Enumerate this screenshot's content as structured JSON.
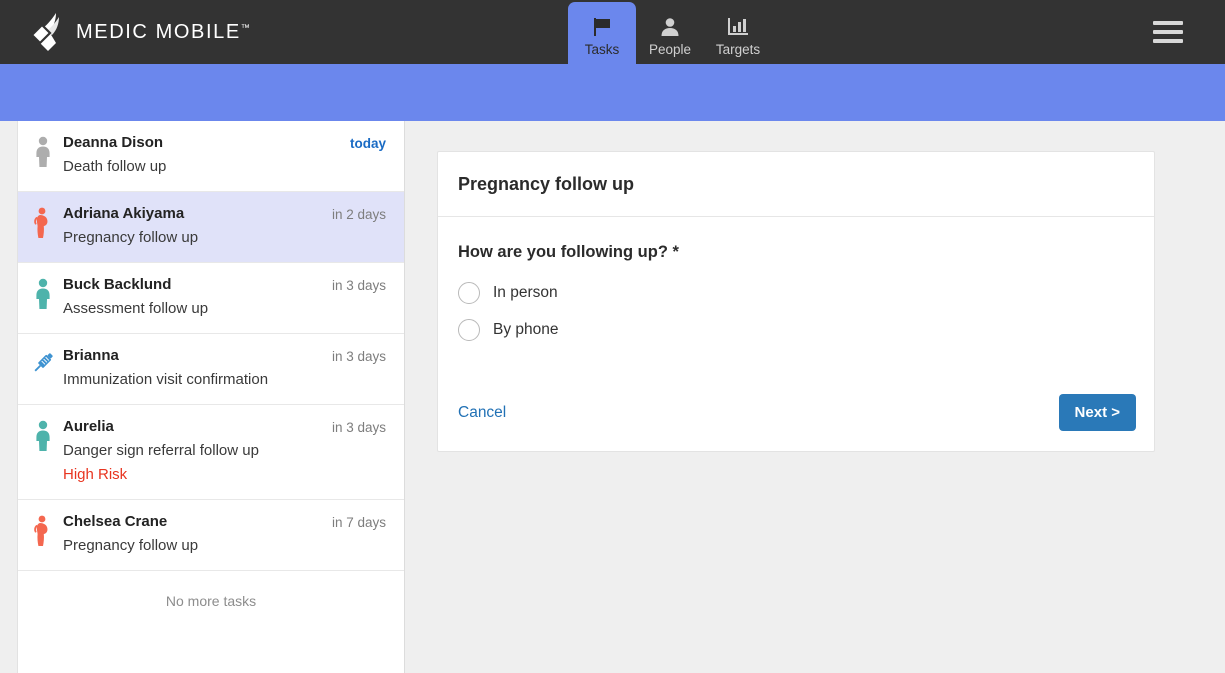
{
  "brand": {
    "name": "MEDIC MOBILE",
    "trademark": "™",
    "logo_icon": "dove-logo-icon"
  },
  "nav": {
    "tabs": [
      {
        "label": "Tasks",
        "icon": "flag-icon",
        "active": true
      },
      {
        "label": "People",
        "icon": "person-icon",
        "active": false
      },
      {
        "label": "Targets",
        "icon": "bar-chart-icon",
        "active": false
      }
    ],
    "menu_icon": "hamburger-menu-icon",
    "accent_color": "#6b87ed",
    "bar_color": "#333333"
  },
  "task_list": {
    "items": [
      {
        "name": "Deanna Dison",
        "description": "Death follow up",
        "due": "today",
        "due_highlight": true,
        "icon": "person-gray-icon",
        "icon_color": "#adadad",
        "selected": false,
        "risk": ""
      },
      {
        "name": "Adriana Akiyama",
        "description": "Pregnancy follow up",
        "due": "in 2 days",
        "due_highlight": false,
        "icon": "pregnant-woman-icon",
        "icon_color": "#f4674f",
        "selected": true,
        "risk": ""
      },
      {
        "name": "Buck Backlund",
        "description": "Assessment follow up",
        "due": "in 3 days",
        "due_highlight": false,
        "icon": "person-teal-icon",
        "icon_color": "#4eb3ab",
        "selected": false,
        "risk": ""
      },
      {
        "name": "Brianna",
        "description": "Immunization visit confirmation",
        "due": "in 3 days",
        "due_highlight": false,
        "icon": "syringe-icon",
        "icon_color": "#3f93d1",
        "selected": false,
        "risk": ""
      },
      {
        "name": "Aurelia",
        "description": "Danger sign referral follow up",
        "due": "in 3 days",
        "due_highlight": false,
        "icon": "person-teal-icon",
        "icon_color": "#4eb3ab",
        "selected": false,
        "risk": "High Risk"
      },
      {
        "name": "Chelsea Crane",
        "description": "Pregnancy follow up",
        "due": "in 7 days",
        "due_highlight": false,
        "icon": "pregnant-woman-icon",
        "icon_color": "#f4674f",
        "selected": false,
        "risk": ""
      }
    ],
    "end_message": "No more tasks",
    "selected_background": "#e0e2f9",
    "risk_color": "#e8341f",
    "today_color": "#1a6bc4"
  },
  "form": {
    "title": "Pregnancy follow up",
    "question": "How are you following up? *",
    "options": [
      {
        "label": "In person",
        "selected": false
      },
      {
        "label": "By phone",
        "selected": false
      }
    ],
    "cancel_label": "Cancel",
    "next_label": "Next >",
    "next_color": "#2a79b8",
    "cancel_color": "#2171b5"
  }
}
